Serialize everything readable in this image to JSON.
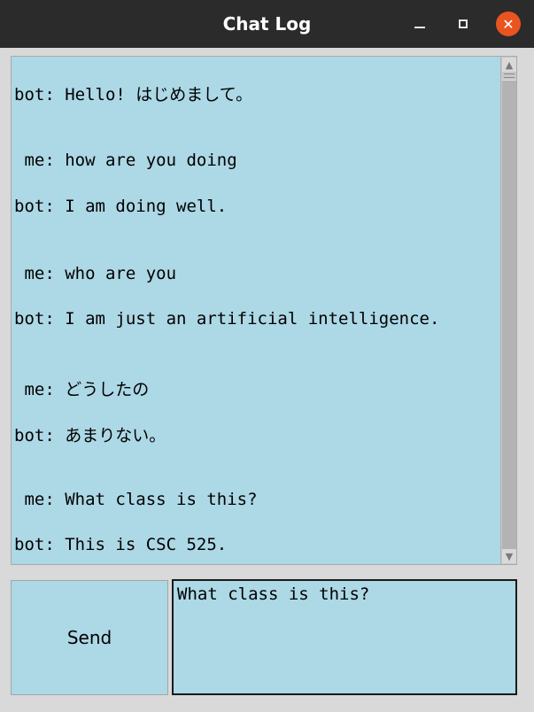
{
  "window": {
    "title": "Chat Log",
    "controls": {
      "minimize_icon": "minimize-icon",
      "maximize_icon": "maximize-icon",
      "close_icon": "close-icon",
      "close_glyph": "✕",
      "close_color": "#e95420"
    }
  },
  "chat": {
    "background": "#add8e6",
    "messages": [
      "bot: Hello! はじめまして。",
      " me: how are you doing",
      "bot: I am doing well.",
      " me: who are you",
      "bot: I am just an artificial intelligence.",
      " me: どうしたの",
      "bot: あまりない。",
      " me: What class is this?",
      "bot: This is CSC 525."
    ]
  },
  "input": {
    "send_label": "Send",
    "entry_value": "What class is this?"
  },
  "scrollbar": {
    "up_glyph": "▲",
    "down_glyph": "▼"
  }
}
